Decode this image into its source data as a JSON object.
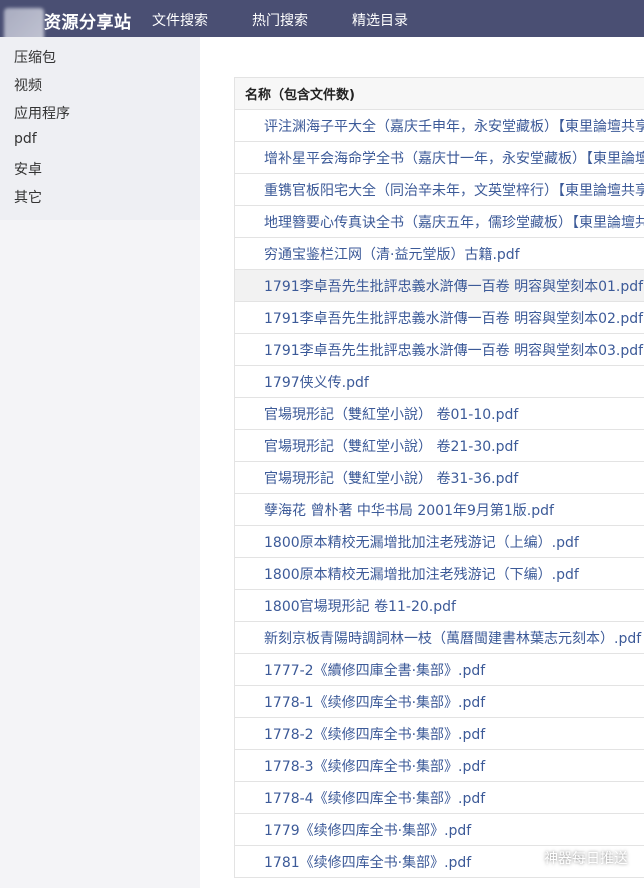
{
  "brand": {
    "name": "资源分享站"
  },
  "nav": {
    "items": [
      {
        "label": "文件搜索"
      },
      {
        "label": "热门搜索"
      },
      {
        "label": "精选目录"
      }
    ]
  },
  "sidebar": {
    "items": [
      {
        "label": "压缩包"
      },
      {
        "label": "视频"
      },
      {
        "label": "应用程序"
      },
      {
        "label": "pdf"
      },
      {
        "label": "安卓"
      },
      {
        "label": "其它"
      }
    ]
  },
  "table": {
    "header": "名称（包含文件数)",
    "rows": [
      "评注渊海子平大全（嘉庆壬申年，永安堂藏板）【東里論壇共享",
      "增补星平会海命学全书（嘉庆廿一年，永安堂藏板）【東里論壇共享",
      "重镌官板阳宅大全（同治辛未年，文英堂梓行）【東里論壇共享",
      "地理簪要心传真诀全书（嘉庆五年，儒珍堂藏板）【東里論壇共享",
      "穷通宝鉴栏江网（清·益元堂版）古籍.pdf",
      "1791李卓吾先生批評忠義水滸傳一百卷 明容與堂刻本01.pdf",
      "1791李卓吾先生批評忠義水滸傳一百卷 明容與堂刻本02.pdf",
      "1791李卓吾先生批評忠義水滸傳一百卷 明容與堂刻本03.pdf",
      "1797侠义传.pdf",
      "官場現形記（雙紅堂小說） 卷01-10.pdf",
      "官場現形記（雙紅堂小說） 卷21-30.pdf",
      "官場現形記（雙紅堂小說） 卷31-36.pdf",
      "孽海花 曾朴著 中华书局 2001年9月第1版.pdf",
      "1800原本精校无漏增批加注老残游记（上编）.pdf",
      "1800原本精校无漏增批加注老残游记（下编）.pdf",
      "1800官場現形記 卷11-20.pdf",
      "新刻京板青陽時調詞林一枝（萬曆閩建書林葉志元刻本）.pdf",
      "1777-2《續修四庫全書·集部》.pdf",
      "1778-1《续修四库全书·集部》.pdf",
      "1778-2《续修四库全书·集部》.pdf",
      "1778-3《续修四库全书·集部》.pdf",
      "1778-4《续修四库全书·集部》.pdf",
      "1779《续修四库全书·集部》.pdf",
      "1781《续修四库全书·集部》.pdf"
    ]
  },
  "watermark": {
    "text": "神器每日推送"
  },
  "colors": {
    "topbar": "#4a4f73",
    "link": "#3c5a98"
  }
}
